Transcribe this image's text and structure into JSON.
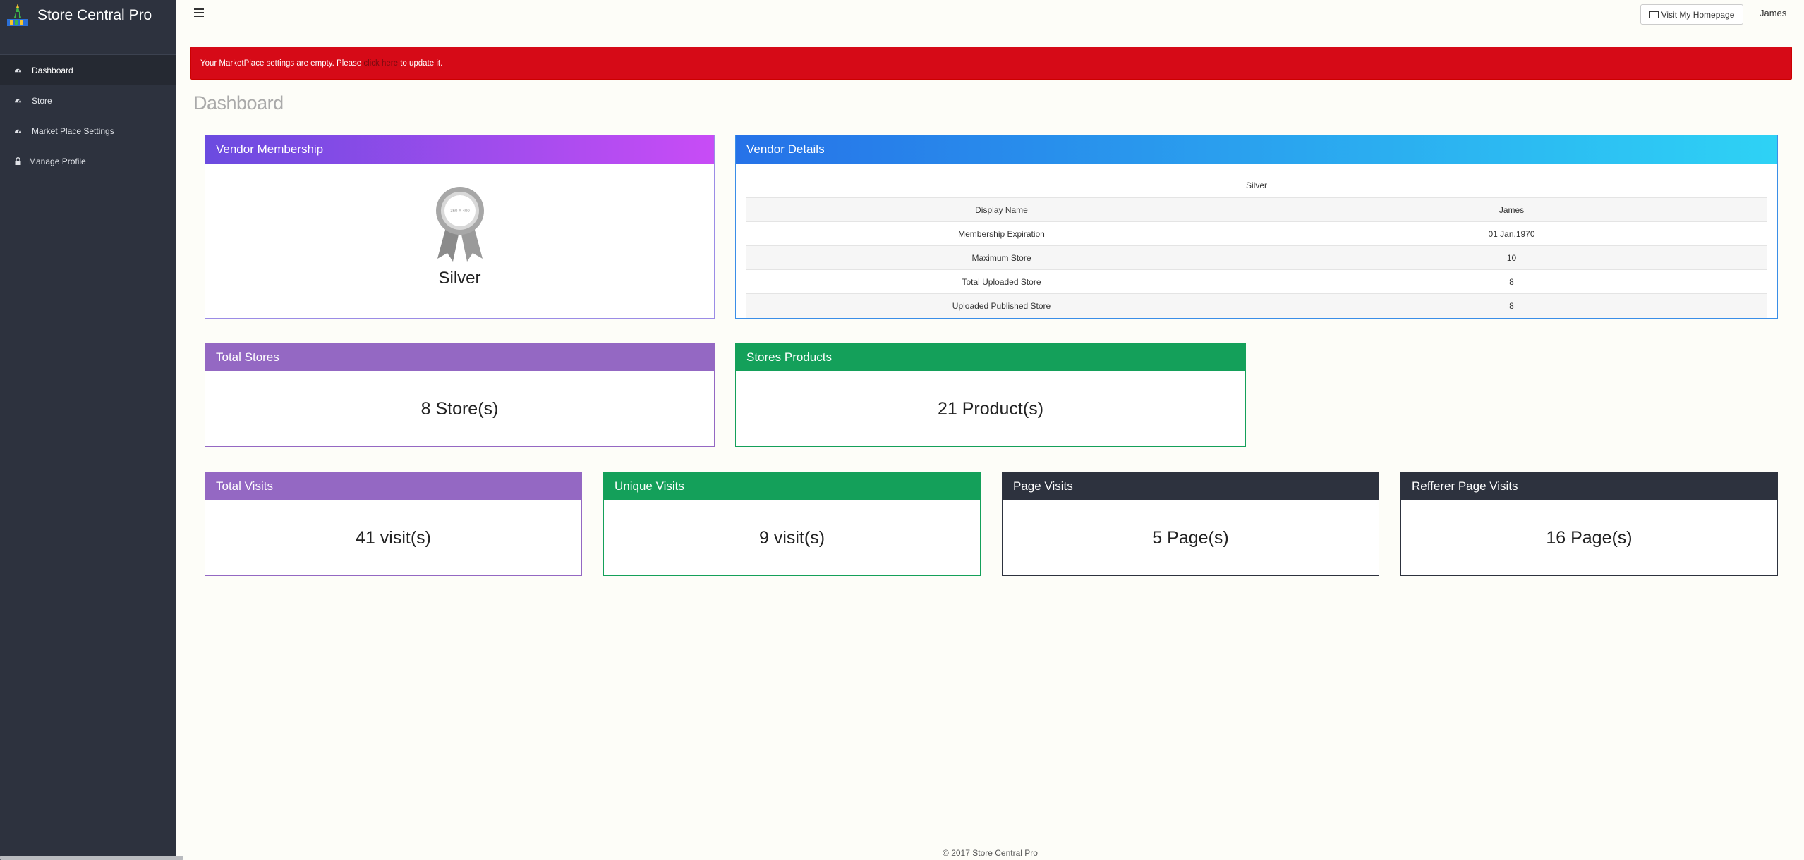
{
  "brand": {
    "name": "Store Central Pro",
    "logo_icon": "store-logo-icon"
  },
  "sidebar": {
    "items": [
      {
        "label": "Dashboard",
        "icon": "dashboard-icon",
        "active": true
      },
      {
        "label": "Store",
        "icon": "dashboard-icon",
        "active": false
      },
      {
        "label": "Market Place Settings",
        "icon": "dashboard-icon",
        "active": false
      },
      {
        "label": "Manage Profile",
        "icon": "lock-icon",
        "active": false
      }
    ]
  },
  "topbar": {
    "menu_icon": "hamburger-icon",
    "visit_button": "Visit My Homepage",
    "visit_icon": "monitor-icon",
    "user": "James"
  },
  "alert": {
    "text_before": "Your MarketPlace settings are empty. Please",
    "link_text": "click here",
    "text_after": "to update it.",
    "color": "#d60a17"
  },
  "page": {
    "title": "Dashboard"
  },
  "membership": {
    "title": "Vendor Membership",
    "level": "Silver",
    "badge_text": "360 X 400"
  },
  "vendor_details": {
    "title": "Vendor Details",
    "tier": "Silver",
    "rows": [
      {
        "label": "Display Name",
        "value": "James"
      },
      {
        "label": "Membership Expiration",
        "value": "01 Jan,1970"
      },
      {
        "label": "Maximum Store",
        "value": "10"
      },
      {
        "label": "Total Uploaded Store",
        "value": "8"
      },
      {
        "label": "Uploaded Published Store",
        "value": "8"
      }
    ]
  },
  "stats": {
    "total_stores": {
      "title": "Total Stores",
      "value": "8 Store(s)"
    },
    "store_products": {
      "title": "Stores Products",
      "value": "21 Product(s)"
    },
    "total_visits": {
      "title": "Total Visits",
      "value": "41 visit(s)"
    },
    "unique_visits": {
      "title": "Unique Visits",
      "value": "9 visit(s)"
    },
    "page_visits": {
      "title": "Page Visits",
      "value": "5 Page(s)"
    },
    "referrer_visits": {
      "title": "Refferer Page Visits",
      "value": "16 Page(s)"
    }
  },
  "footer": {
    "text": "© 2017 Store Central Pro"
  }
}
